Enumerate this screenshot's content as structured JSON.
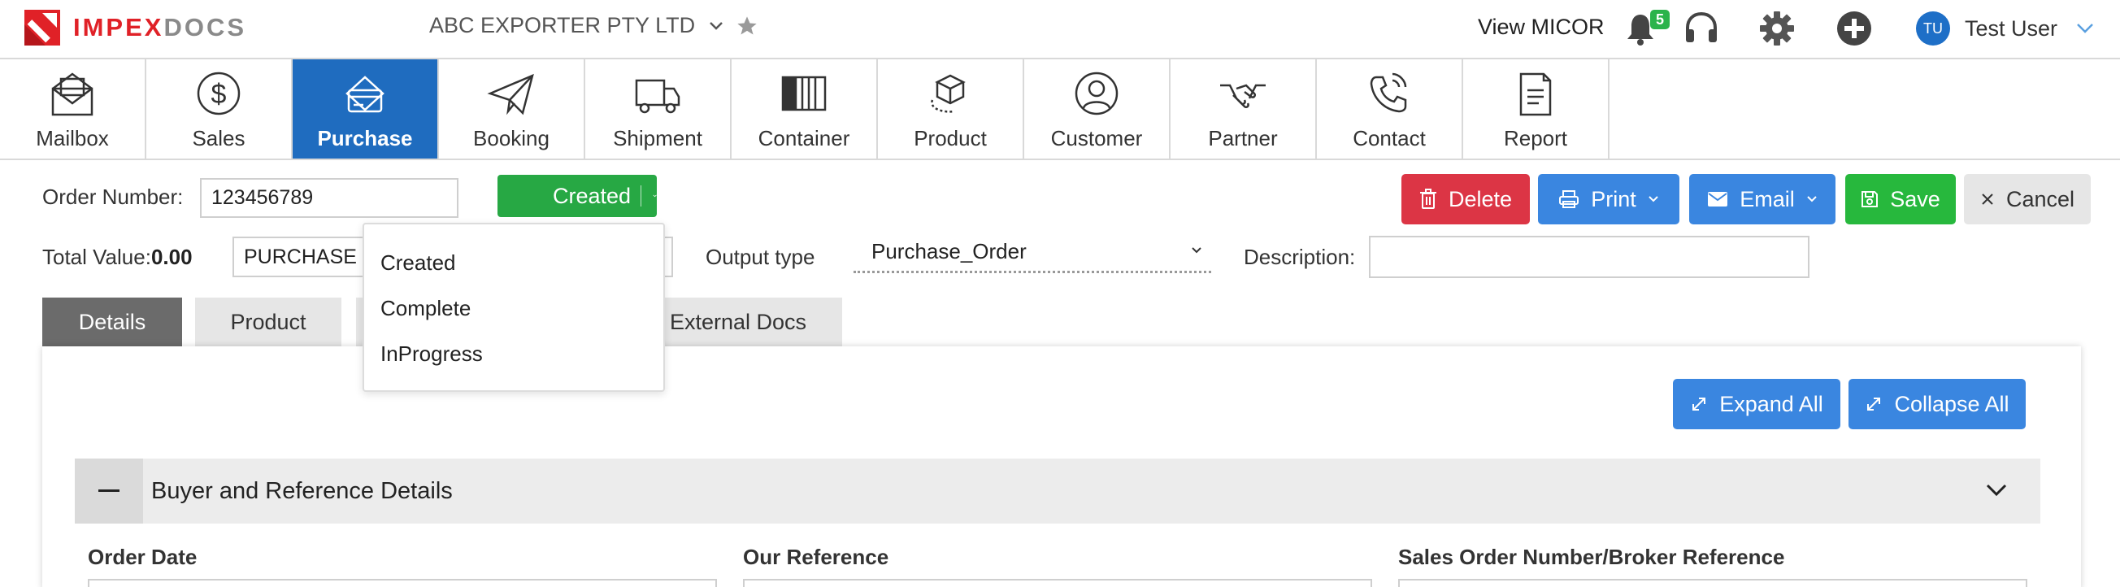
{
  "brand": {
    "impex": "IMPEX",
    "docs": "DOCS"
  },
  "header": {
    "company": "ABC EXPORTER PTY LTD",
    "view_micor": "View MICOR",
    "notification_count": "5",
    "user_initials": "TU",
    "user_name": "Test User"
  },
  "nav": [
    {
      "label": "Mailbox",
      "icon": "mailbox-icon"
    },
    {
      "label": "Sales",
      "icon": "dollar-icon"
    },
    {
      "label": "Purchase",
      "icon": "credit-card-icon",
      "active": true
    },
    {
      "label": "Booking",
      "icon": "paper-plane-icon"
    },
    {
      "label": "Shipment",
      "icon": "truck-icon"
    },
    {
      "label": "Container",
      "icon": "container-icon"
    },
    {
      "label": "Product",
      "icon": "box-icon"
    },
    {
      "label": "Customer",
      "icon": "user-icon"
    },
    {
      "label": "Partner",
      "icon": "handshake-icon"
    },
    {
      "label": "Contact",
      "icon": "phone-icon"
    },
    {
      "label": "Report",
      "icon": "document-icon"
    }
  ],
  "order": {
    "number_label": "Order Number:",
    "number_value": "123456789",
    "status": "Created",
    "total_label": "Total Value:",
    "total_value": "0.00",
    "purchase_type_value": "PURCHASE C",
    "output_type_label": "Output type",
    "output_type_value": "Purchase_Order",
    "description_label": "Description:"
  },
  "actions": {
    "delete": "Delete",
    "print": "Print",
    "email": "Email",
    "save": "Save",
    "cancel": "Cancel"
  },
  "tabs": {
    "details": "Details",
    "product": "Product",
    "external_docs": "External Docs"
  },
  "panel": {
    "expand_all": "Expand All",
    "collapse_all": "Collapse All",
    "section_title": "Buyer and Reference Details",
    "fields": {
      "order_date": "Order Date",
      "our_reference": "Our Reference",
      "sales_order": "Sales Order Number/Broker Reference"
    }
  },
  "status_dropdown": {
    "options": [
      "Created",
      "Complete",
      "InProgress"
    ]
  },
  "colors": {
    "brand_red": "#e02127",
    "nav_active": "#1f6cbf",
    "status_green": "#27a844",
    "delete": "#dc3545",
    "primary": "#3a86e0",
    "save": "#27b83d"
  }
}
